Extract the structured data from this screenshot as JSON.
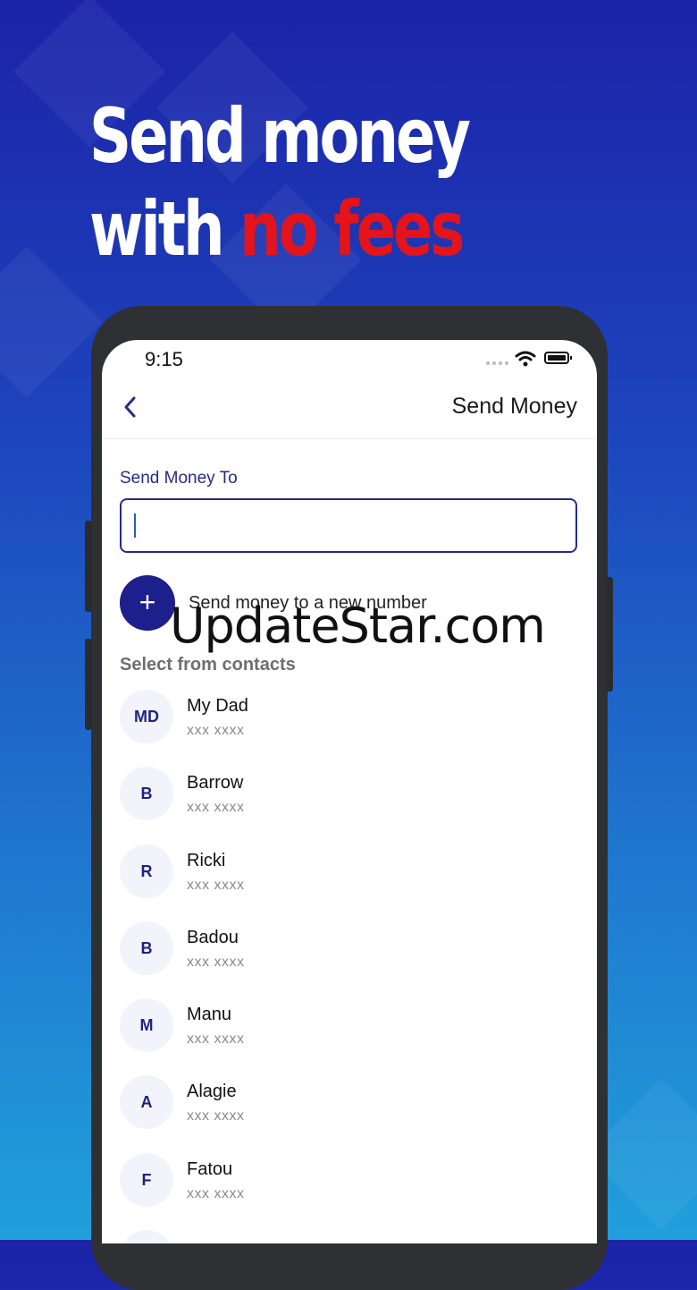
{
  "headline": {
    "line1": "Send money",
    "line2_prefix": "with ",
    "line2_accent": "no fees",
    "accent_color": "#e3141b"
  },
  "status_bar": {
    "time": "9:15"
  },
  "nav": {
    "back_icon": "chevron-left-icon",
    "title": "Send Money"
  },
  "form": {
    "label": "Send Money To",
    "value": "",
    "placeholder": ""
  },
  "new_number": {
    "icon": "plus-icon",
    "label": "Send money to a new number"
  },
  "watermark": "UpdateStar.com",
  "contacts": {
    "label": "Select from contacts",
    "items": [
      {
        "initials": "MD",
        "name": "My Dad",
        "phone": "xxx xxxx"
      },
      {
        "initials": "B",
        "name": "Barrow",
        "phone": "xxx xxxx"
      },
      {
        "initials": "R",
        "name": "Ricki",
        "phone": "xxx xxxx"
      },
      {
        "initials": "B",
        "name": "Badou",
        "phone": "xxx xxxx"
      },
      {
        "initials": "M",
        "name": "Manu",
        "phone": "xxx xxxx"
      },
      {
        "initials": "A",
        "name": "Alagie",
        "phone": "xxx xxxx"
      },
      {
        "initials": "F",
        "name": "Fatou",
        "phone": "xxx xxxx"
      }
    ]
  },
  "colors": {
    "primary": "#1c1f8c",
    "label": "#262a8a"
  }
}
